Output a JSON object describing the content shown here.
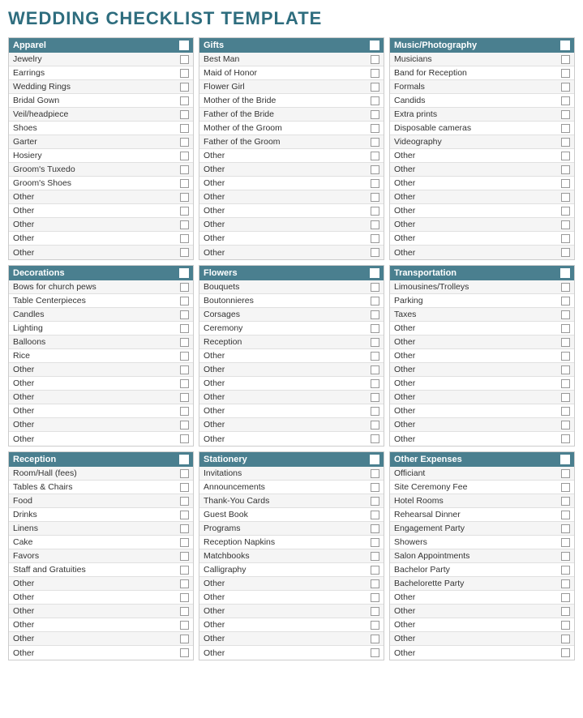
{
  "title": "WEDDING CHECKLIST TEMPLATE",
  "sections": [
    {
      "id": "apparel",
      "header": "Apparel",
      "items": [
        "Jewelry",
        "Earrings",
        "Wedding Rings",
        "Bridal Gown",
        "Veil/headpiece",
        "Shoes",
        "Garter",
        "Hosiery",
        "Groom's Tuxedo",
        "Groom's Shoes",
        "Other",
        "Other",
        "Other",
        "Other",
        "Other"
      ]
    },
    {
      "id": "gifts",
      "header": "Gifts",
      "items": [
        "Best Man",
        "Maid of Honor",
        "Flower Girl",
        "Mother of the Bride",
        "Father of the Bride",
        "Mother of the Groom",
        "Father of the Groom",
        "Other",
        "Other",
        "Other",
        "Other",
        "Other",
        "Other",
        "Other",
        "Other"
      ]
    },
    {
      "id": "music-photography",
      "header": "Music/Photography",
      "items": [
        "Musicians",
        "Band for Reception",
        "Formals",
        "Candids",
        "Extra prints",
        "Disposable cameras",
        "Videography",
        "Other",
        "Other",
        "Other",
        "Other",
        "Other",
        "Other",
        "Other",
        "Other"
      ]
    },
    {
      "id": "decorations",
      "header": "Decorations",
      "items": [
        "Bows for church pews",
        "Table Centerpieces",
        "Candles",
        "Lighting",
        "Balloons",
        "Rice",
        "Other",
        "Other",
        "Other",
        "Other",
        "Other",
        "Other"
      ]
    },
    {
      "id": "flowers",
      "header": "Flowers",
      "items": [
        "Bouquets",
        "Boutonnieres",
        "Corsages",
        "Ceremony",
        "Reception",
        "Other",
        "Other",
        "Other",
        "Other",
        "Other",
        "Other",
        "Other"
      ]
    },
    {
      "id": "transportation",
      "header": "Transportation",
      "items": [
        "Limousines/Trolleys",
        "Parking",
        "Taxes",
        "Other",
        "Other",
        "Other",
        "Other",
        "Other",
        "Other",
        "Other",
        "Other",
        "Other"
      ]
    },
    {
      "id": "reception",
      "header": "Reception",
      "items": [
        "Room/Hall (fees)",
        "Tables & Chairs",
        "Food",
        "Drinks",
        "Linens",
        "Cake",
        "Favors",
        "Staff and Gratuities",
        "Other",
        "Other",
        "Other",
        "Other",
        "Other",
        "Other"
      ]
    },
    {
      "id": "stationery",
      "header": "Stationery",
      "items": [
        "Invitations",
        "Announcements",
        "Thank-You Cards",
        "Guest Book",
        "Programs",
        "Reception Napkins",
        "Matchbooks",
        "Calligraphy",
        "Other",
        "Other",
        "Other",
        "Other",
        "Other",
        "Other"
      ]
    },
    {
      "id": "other-expenses",
      "header": "Other Expenses",
      "items": [
        "Officiant",
        "Site Ceremony Fee",
        "Hotel Rooms",
        "Rehearsal Dinner",
        "Engagement Party",
        "Showers",
        "Salon Appointments",
        "Bachelor Party",
        "Bachelorette Party",
        "Other",
        "Other",
        "Other",
        "Other",
        "Other"
      ]
    }
  ]
}
